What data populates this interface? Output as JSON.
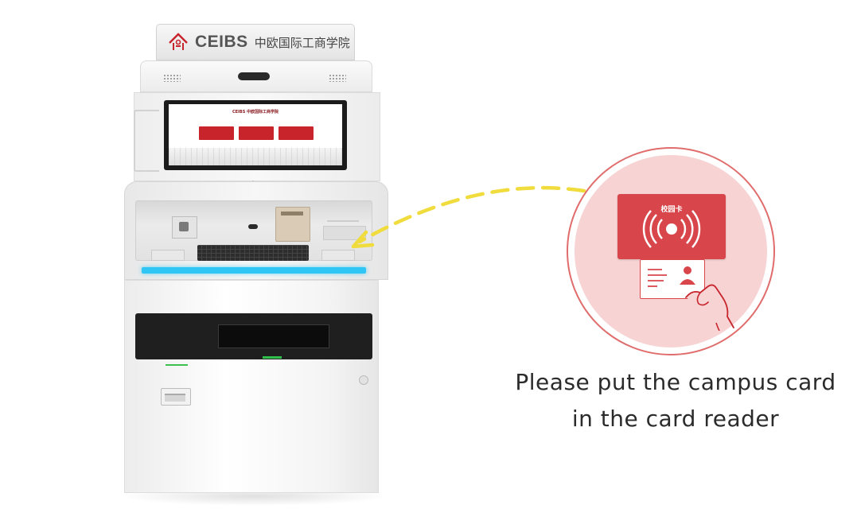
{
  "kiosk": {
    "sign_brand": "CEIBS",
    "sign_chinese": "中欧国际工商学院",
    "screen_header": "CEIBS 中欧国际工商学院",
    "screen_tiles": [
      "",
      "",
      ""
    ],
    "output_label_top": "",
    "output_label_bottom": "",
    "card_return_label": "",
    "id_reader_label": ""
  },
  "illustration": {
    "campus_card_label": "校园卡",
    "accent_color": "#d8464b",
    "circle_color": "#f7d3d3",
    "icons": [
      "nfc-waves-icon",
      "person-icon",
      "hand-icon"
    ]
  },
  "arrow": {
    "color": "#f0dc3c",
    "style": "dashed"
  },
  "instruction": {
    "line1": "Please put the campus card",
    "line2": "in the card reader"
  }
}
